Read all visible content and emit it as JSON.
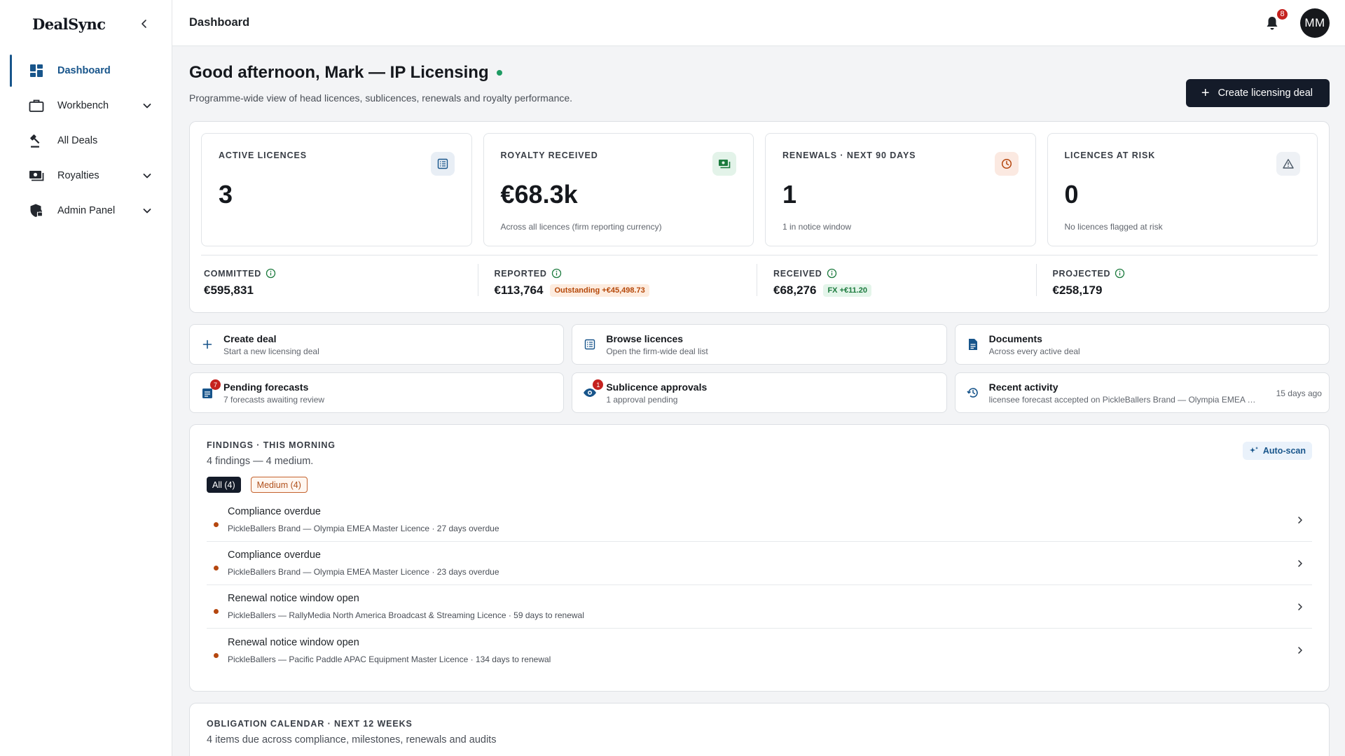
{
  "app": {
    "brand": "DealSync"
  },
  "sidebar": {
    "items": [
      {
        "label": "Dashboard",
        "icon": "dashboard-icon",
        "active": true,
        "expandable": false
      },
      {
        "label": "Workbench",
        "icon": "briefcase-icon",
        "active": false,
        "expandable": true
      },
      {
        "label": "All Deals",
        "icon": "gavel-icon",
        "active": false,
        "expandable": false
      },
      {
        "label": "Royalties",
        "icon": "money-icon",
        "active": false,
        "expandable": true
      },
      {
        "label": "Admin Panel",
        "icon": "shield-lock-icon",
        "active": false,
        "expandable": true
      }
    ]
  },
  "topbar": {
    "title": "Dashboard",
    "notification_count": "8",
    "avatar_initials": "MM"
  },
  "header": {
    "greeting": "Good afternoon, Mark — IP Licensing",
    "subtitle": "Programme-wide view of head licences, sublicences, renewals and royalty performance.",
    "create_button": "Create licensing deal"
  },
  "kpis": [
    {
      "label": "ACTIVE LICENCES",
      "value": "3",
      "sub": "",
      "icon": "list-icon"
    },
    {
      "label": "ROYALTY RECEIVED",
      "value": "€68.3k",
      "sub": "Across all licences (firm reporting currency)",
      "icon": "cash-icon"
    },
    {
      "label": "RENEWALS · NEXT 90 DAYS",
      "value": "1",
      "sub": "1 in notice window",
      "icon": "clock-icon"
    },
    {
      "label": "LICENCES AT RISK",
      "value": "0",
      "sub": "No licences flagged at risk",
      "icon": "warning-icon"
    }
  ],
  "money": {
    "committed": {
      "label": "COMMITTED",
      "value": "€595,831"
    },
    "reported": {
      "label": "REPORTED",
      "value": "€113,764",
      "chip": "Outstanding +€45,498.73"
    },
    "received": {
      "label": "RECEIVED",
      "value": "€68,276",
      "chip": "FX +€11.20"
    },
    "projected": {
      "label": "PROJECTED",
      "value": "€258,179"
    }
  },
  "quick_actions": [
    {
      "title": "Create deal",
      "sub": "Start a new licensing deal",
      "icon": "plus-icon"
    },
    {
      "title": "Browse licences",
      "sub": "Open the firm-wide deal list",
      "icon": "list-icon"
    },
    {
      "title": "Documents",
      "sub": "Across every active deal",
      "icon": "document-icon"
    },
    {
      "title": "Pending forecasts",
      "sub": "7 forecasts awaiting review",
      "icon": "forecast-icon",
      "badge": "7"
    },
    {
      "title": "Sublicence approvals",
      "sub": "1 approval pending",
      "icon": "eye-icon",
      "badge": "1"
    },
    {
      "title": "Recent activity",
      "sub": "licensee forecast accepted on PickleBallers Brand — Olympia EMEA …",
      "icon": "history-icon",
      "time": "15 days ago"
    }
  ],
  "findings": {
    "label": "FINDINGS · THIS MORNING",
    "summary": "4 findings — 4 medium.",
    "autoscan_label": "Auto-scan",
    "filters": {
      "all": "All (4)",
      "medium": "Medium (4)"
    },
    "items": [
      {
        "title": "Compliance overdue",
        "sub": "PickleBallers Brand — Olympia EMEA Master Licence · 27 days overdue"
      },
      {
        "title": "Compliance overdue",
        "sub": "PickleBallers Brand — Olympia EMEA Master Licence · 23 days overdue"
      },
      {
        "title": "Renewal notice window open",
        "sub": "PickleBallers — RallyMedia North America Broadcast & Streaming Licence · 59 days to renewal"
      },
      {
        "title": "Renewal notice window open",
        "sub": "PickleBallers — Pacific Paddle APAC Equipment Master Licence · 134 days to renewal"
      }
    ]
  },
  "calendar": {
    "label": "OBLIGATION CALENDAR · NEXT 12 WEEKS",
    "summary": "4 items due across compliance, milestones, renewals and audits"
  },
  "colors": {
    "accent": "#18558b",
    "primary_button": "#141b29",
    "warning": "#b54708",
    "success": "#1b7a3d",
    "danger": "#c5221f"
  }
}
